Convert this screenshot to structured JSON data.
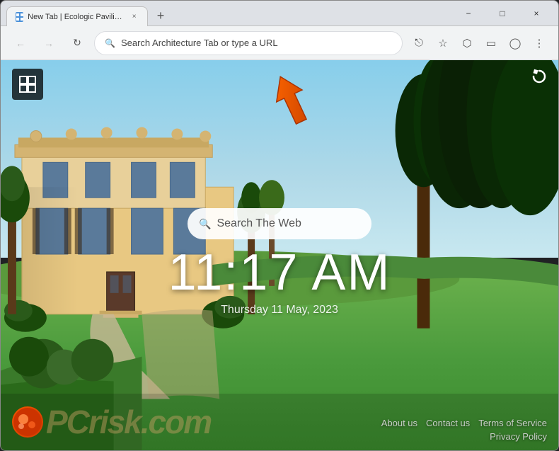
{
  "browser": {
    "tab_title": "New Tab | Ecologic Pavilion In Al...",
    "new_tab_symbol": "+",
    "window_controls": {
      "minimize": "−",
      "maximize": "□",
      "close": "×"
    },
    "nav": {
      "back_disabled": true,
      "forward_disabled": true,
      "address_placeholder": "Search Architecture Tab or type a URL",
      "address_value": "Search Architecture Tab or type a URL"
    }
  },
  "page": {
    "logo_symbol": "⊞",
    "search_placeholder": "Search The Web",
    "clock": {
      "time": "11:17 AM",
      "date": "Thursday 11 May, 2023"
    },
    "footer": {
      "row1": {
        "about": "About us",
        "contact": "Contact us",
        "terms": "Terms of Service"
      },
      "row2": {
        "privacy": "Privacy Policy"
      }
    },
    "watermark": "PCrisk.com"
  },
  "icons": {
    "search": "🔍",
    "back": "←",
    "forward": "→",
    "reload": "↻",
    "share": "⎋",
    "bookmark": "☆",
    "extensions": "⬡",
    "tabsearch": "▭",
    "profile": "◯",
    "menu": "⋮",
    "page_refresh": "↺"
  }
}
